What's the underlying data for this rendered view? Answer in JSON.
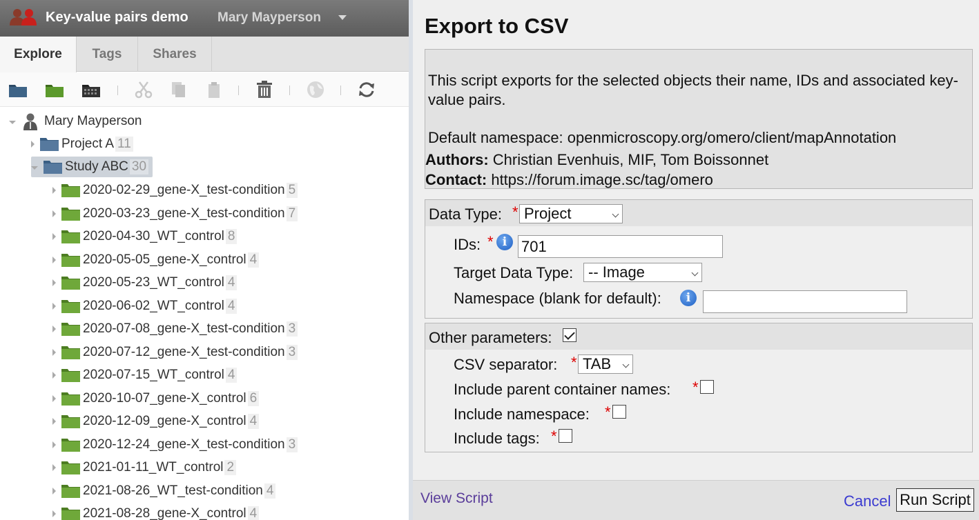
{
  "header": {
    "group_icon": "group-icon",
    "group_name": "Key-value pairs demo",
    "user_name": "Mary Mayperson"
  },
  "tabs": [
    {
      "label": "Explore",
      "active": true
    },
    {
      "label": "Tags",
      "active": false
    },
    {
      "label": "Shares",
      "active": false
    }
  ],
  "toolbar": {
    "icons": [
      "new-project-icon",
      "new-dataset-icon",
      "new-screen-icon",
      "cut-icon",
      "copy-icon",
      "paste-icon",
      "delete-icon",
      "share-icon",
      "refresh-icon"
    ]
  },
  "tree": {
    "root": {
      "label": "Mary Mayperson",
      "icon": "user-icon"
    },
    "projects": [
      {
        "label": "Project A",
        "count": "11",
        "expanded": false
      },
      {
        "label": "Study ABC",
        "count": "30",
        "expanded": true,
        "selected": true
      }
    ],
    "datasets": [
      {
        "label": "2020-02-29_gene-X_test-condition",
        "count": "5"
      },
      {
        "label": "2020-03-23_gene-X_test-condition",
        "count": "7"
      },
      {
        "label": "2020-04-30_WT_control",
        "count": "8"
      },
      {
        "label": "2020-05-05_gene-X_control",
        "count": "4"
      },
      {
        "label": "2020-05-23_WT_control",
        "count": "4"
      },
      {
        "label": "2020-06-02_WT_control",
        "count": "4"
      },
      {
        "label": "2020-07-08_gene-X_test-condition",
        "count": "3"
      },
      {
        "label": "2020-07-12_gene-X_test-condition",
        "count": "3"
      },
      {
        "label": "2020-07-15_WT_control",
        "count": "4"
      },
      {
        "label": "2020-10-07_gene-X_control",
        "count": "6"
      },
      {
        "label": "2020-12-09_gene-X_control",
        "count": "4"
      },
      {
        "label": "2020-12-24_gene-X_test-condition",
        "count": "3"
      },
      {
        "label": "2021-01-11_WT_control",
        "count": "2"
      },
      {
        "label": "2021-08-26_WT_test-condition",
        "count": "4"
      },
      {
        "label": "2021-08-28_gene-X_control",
        "count": "4"
      }
    ]
  },
  "dialog": {
    "title": "Export to CSV",
    "description": "This script exports for the selected objects their name, IDs and associated key-value pairs.",
    "namespace_line": "Default namespace: openmicroscopy.org/omero/client/mapAnnotation",
    "authors_label": "Authors:",
    "authors": " Christian Evenhuis, MIF, Tom Boissonnet",
    "contact_label": "Contact:",
    "contact": " https://forum.image.sc/tag/omero",
    "data_type": {
      "label": "Data Type:",
      "value": "Project"
    },
    "ids": {
      "label": "IDs:",
      "value": "701"
    },
    "target_type": {
      "label": "Target Data Type:",
      "value": "-- Image"
    },
    "namespace": {
      "label": "Namespace (blank for default):",
      "value": ""
    },
    "other_params": {
      "label": "Other parameters:",
      "checked": true
    },
    "csv_separator": {
      "label": "CSV separator:",
      "value": "TAB"
    },
    "include_parent": {
      "label": "Include parent container names:",
      "checked": false
    },
    "include_namespace": {
      "label": "Include namespace:",
      "checked": false
    },
    "include_tags": {
      "label": "Include tags:",
      "checked": false
    },
    "required_mark": "*",
    "info_glyph": "i"
  },
  "footer": {
    "view_script": "View Script",
    "cancel": "Cancel",
    "run": "Run Script"
  }
}
